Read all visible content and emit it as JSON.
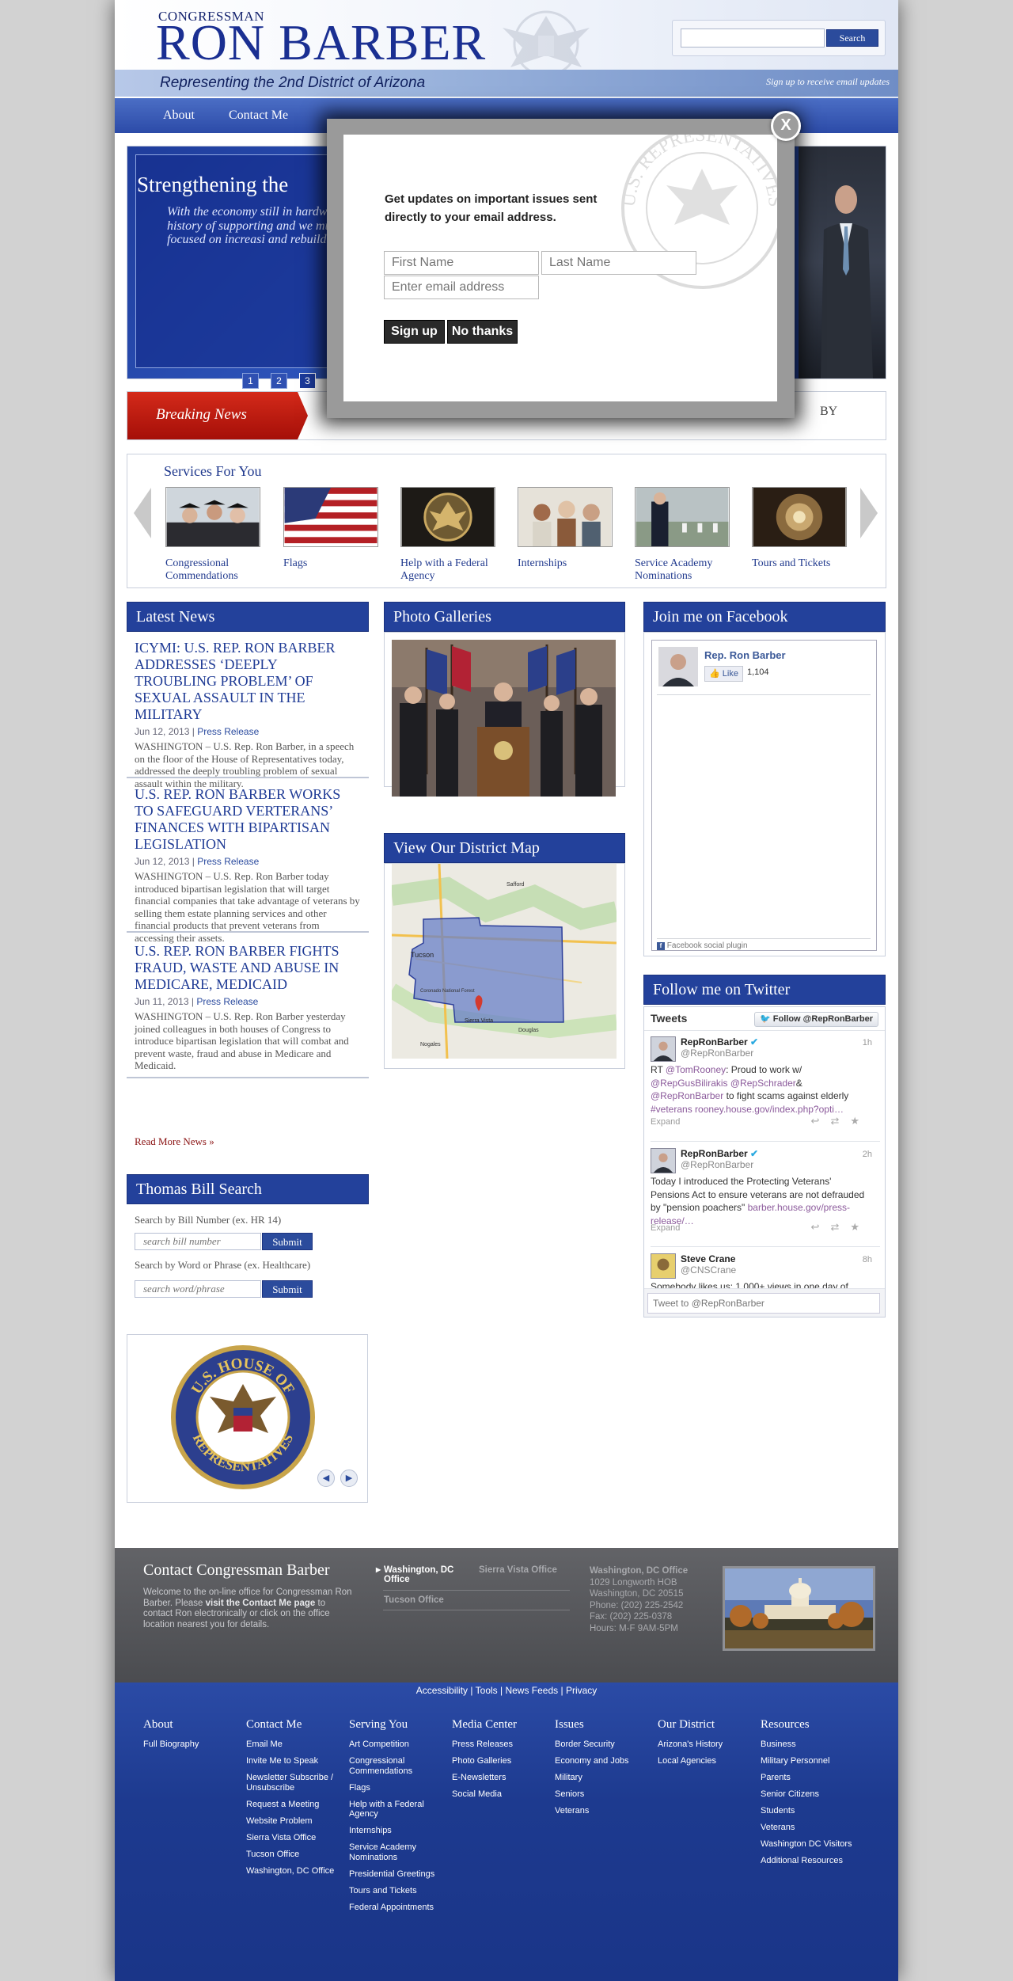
{
  "header": {
    "congressman": "CONGRESSMAN",
    "name": "RON BARBER",
    "tagline": "Representing the 2nd District of Arizona",
    "signup_link": "Sign up to receive email updates",
    "search_button": "Search",
    "search_value": ""
  },
  "nav": {
    "about": "About",
    "contact": "Contact Me"
  },
  "hero": {
    "title": "Strengthening the",
    "body": "With the economy still in hardworking families in S are feeling the burden of ever-increasing costs. Ou long history of supporting and we must continue thi With every issue Barber f – from health care to edu he is focused on increasi and rebuilding the middl",
    "dots": [
      "1",
      "2",
      "3"
    ],
    "active_dot": "3"
  },
  "breaking": {
    "label": "Breaking News",
    "right_text": "BY"
  },
  "services": {
    "title": "Services For You",
    "items": [
      {
        "label": "Congressional Commendations"
      },
      {
        "label": "Flags"
      },
      {
        "label": "Help with a Federal Agency"
      },
      {
        "label": "Internships"
      },
      {
        "label": "Service Academy Nominations"
      },
      {
        "label": "Tours and Tickets"
      }
    ]
  },
  "news": {
    "heading": "Latest News",
    "items": [
      {
        "title": "ICYMI: U.S. REP. RON BARBER ADDRESSES ‘DEEPLY TROUBLING PROBLEM’ OF SEXUAL ASSAULT IN THE MILITARY",
        "date": "Jun 12, 2013",
        "category": "Press Release",
        "body": "WASHINGTON – U.S. Rep. Ron Barber, in a speech on the floor of the House of Representatives today, addressed the deeply troubling problem of sexual assault within the military."
      },
      {
        "title": "U.S. REP. RON BARBER WORKS TO SAFEGUARD VERTERANS’ FINANCES WITH BIPARTISAN LEGISLATION",
        "date": "Jun 12, 2013",
        "category": "Press Release",
        "body": "WASHINGTON – U.S. Rep. Ron Barber today introduced bipartisan legislation that will target financial companies that take advantage of veterans by selling them estate planning services and other financial products that prevent veterans from accessing their assets."
      },
      {
        "title": "U.S. REP. RON BARBER FIGHTS FRAUD, WASTE AND ABUSE IN MEDICARE, MEDICAID",
        "date": "Jun 11, 2013",
        "category": "Press Release",
        "body": "WASHINGTON – U.S. Rep. Ron Barber yesterday joined colleagues in both houses of Congress to introduce bipartisan legislation that will combat and prevent waste, fraud and abuse in Medicare and Medicaid."
      }
    ],
    "read_more": "Read More News »"
  },
  "bill": {
    "heading": "Thomas Bill Search",
    "number_label": "Search by Bill Number (ex. HR 14)",
    "number_placeholder": "search bill number",
    "word_label": "Search by Word or Phrase (ex. Healthcare)",
    "word_placeholder": "search word/phrase",
    "submit": "Submit"
  },
  "seal": {
    "text_top": "U.S. HOUSE OF",
    "text_bottom": "REPRESENTATIVES"
  },
  "gallery": {
    "heading": "Photo Galleries"
  },
  "map": {
    "heading": "View Our District Map",
    "places": [
      "Safford",
      "Tucson",
      "Sierra Vista",
      "Douglas",
      "Nogales",
      "Coronado National Forest"
    ]
  },
  "facebook": {
    "heading": "Join me on Facebook",
    "page_name": "Rep. Ron Barber",
    "like": "Like",
    "count": "1,104",
    "plugin": "Facebook social plugin"
  },
  "twitter": {
    "heading": "Follow me on Twitter",
    "tweets_label": "Tweets",
    "follow": "Follow @RepRonBarber",
    "expand": "Expand",
    "compose_placeholder": "Tweet to @RepRonBarber",
    "tweets": [
      {
        "name": "RepRonBarber",
        "handle": "@RepRonBarber",
        "time": "1h",
        "t1": "RT ",
        "l1": "@TomRooney",
        "t2": ": Proud to work w/ ",
        "l2": "@RepGusBilirakis @RepSchrader",
        "t3": "& ",
        "l3": "@RepRonBarber",
        "t4": " to fight scams against elderly ",
        "l4": "#veterans rooney.house.gov/index.php?opti…"
      },
      {
        "name": "RepRonBarber",
        "handle": "@RepRonBarber",
        "time": "2h",
        "t1": "Today I introduced the Protecting Veterans' Pensions Act to ensure veterans are not defrauded by \"pension poachers\" ",
        "l1": "barber.house.gov/press-release/…"
      },
      {
        "name": "Steve Crane",
        "handle": "@CNSCrane",
        "time": "8h",
        "t1": "Somebody likes us: 1,000+ views in one day of"
      }
    ]
  },
  "contact": {
    "title": "Contact Congressman Barber",
    "text_a": "Welcome to the on-line office for Congressman Ron Barber. Please ",
    "text_b": "visit the Contact Me page",
    "text_c": " to contact Ron electronically or click on the office location nearest you for details.",
    "tab_dc": "Washington, DC Office",
    "tab_sv": "Sierra Vista Office",
    "tab_tucson": "Tucson Office",
    "office_lines": [
      "Washington, DC Office",
      "1029 Longworth HOB",
      "Washington, DC 20515",
      "Phone: (202) 225-2542",
      "Fax: (202) 225-0378",
      "Hours: M-F 9AM-5PM"
    ]
  },
  "footer": {
    "links": [
      "Accessibility",
      "Tools",
      "News Feeds",
      "Privacy"
    ],
    "columns": [
      {
        "title": "About",
        "items": [
          "Full Biography"
        ]
      },
      {
        "title": "Contact Me",
        "items": [
          "Email Me",
          "Invite Me to Speak",
          "Newsletter Subscribe / Unsubscribe",
          "Request a Meeting",
          "Website Problem",
          "Sierra Vista Office",
          "Tucson Office",
          "Washington, DC Office"
        ]
      },
      {
        "title": "Serving You",
        "items": [
          "Art Competition",
          "Congressional Commendations",
          "Flags",
          "Help with a Federal Agency",
          "Internships",
          "Service Academy Nominations",
          "Presidential Greetings",
          "Tours and Tickets",
          "Federal Appointments"
        ]
      },
      {
        "title": "Media Center",
        "items": [
          "Press Releases",
          "Photo Galleries",
          "E-Newsletters",
          "Social Media"
        ]
      },
      {
        "title": "Issues",
        "items": [
          "Border Security",
          "Economy and Jobs",
          "Military",
          "Seniors",
          "Veterans"
        ]
      },
      {
        "title": "Our District",
        "items": [
          "Arizona's History",
          "Local Agencies"
        ]
      },
      {
        "title": "Resources",
        "items": [
          "Business",
          "Military Personnel",
          "Parents",
          "Senior Citizens",
          "Students",
          "Veterans",
          "Washington DC Visitors",
          "Additional Resources"
        ]
      }
    ]
  },
  "modal": {
    "message": "Get updates on important issues sent directly to your email address.",
    "first_name": "First Name",
    "last_name": "Last Name",
    "email": "Enter email address",
    "signup": "Sign up",
    "no_thanks": "No thanks",
    "close": "X",
    "seal_text": "U.S. REPRESENTATIVES"
  },
  "colors": {
    "brand_blue": "#23419b",
    "nav_blue": "#2c4ba8",
    "breaking_red": "#c41e12",
    "footer_blue": "#1d3a8f"
  }
}
